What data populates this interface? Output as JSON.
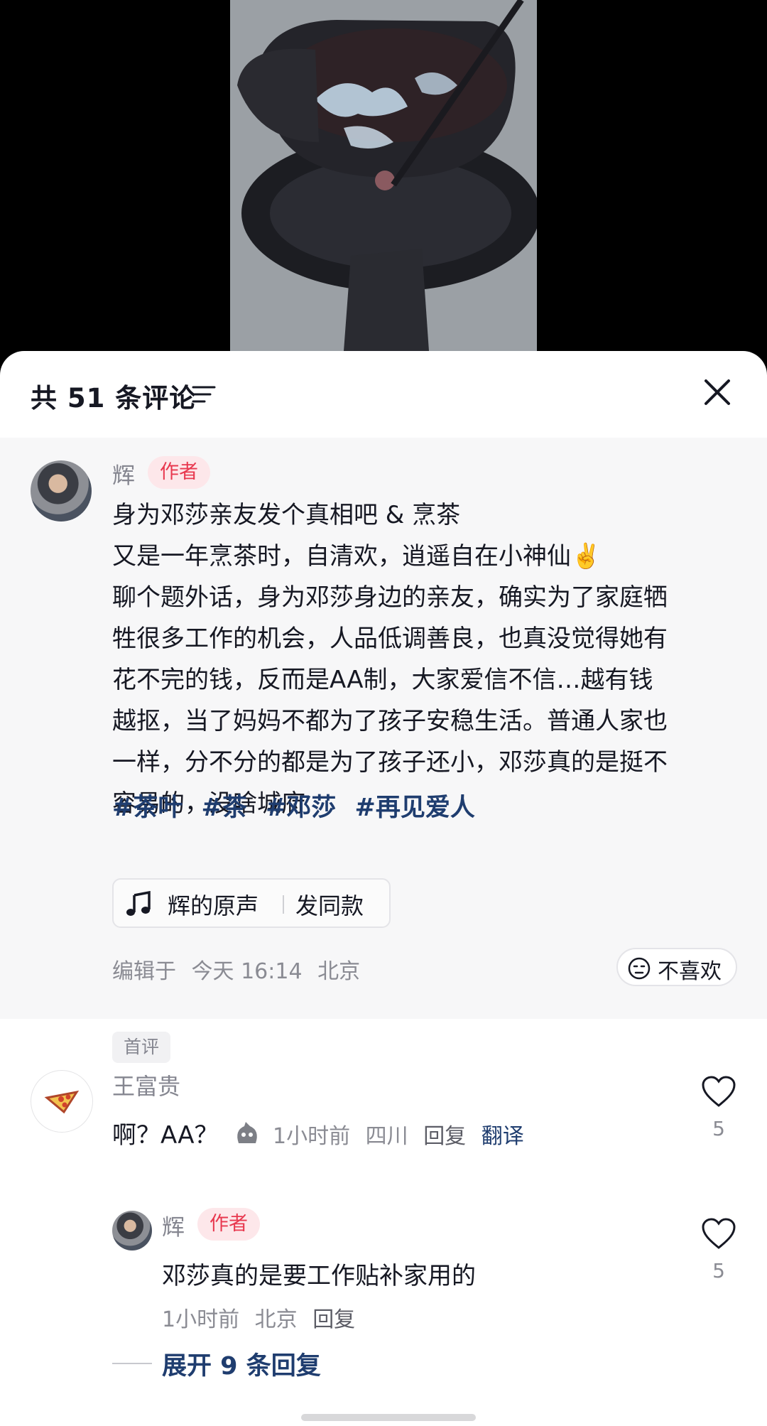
{
  "comments_sheet": {
    "title": "共 51 条评论",
    "pinned_post": {
      "author": "辉",
      "author_badge": "作者",
      "lines": [
        "身为邓莎亲友发个真相吧 & 烹茶",
        "又是一年烹茶时，自清欢，逍遥自在小神仙✌️",
        "聊个题外话，身为邓莎身边的亲友，确实为了家庭牺",
        "牲很多工作的机会，人品低调善良，也真没觉得她有",
        "花不完的钱，反而是AA制，大家爱信不信…越有钱",
        "越抠，当了妈妈不都为了孩子安稳生活。普通人家也",
        "一样，分不分的都是为了孩子还小，邓莎真的是挺不",
        "容易的，没啥城府"
      ],
      "hashtags": [
        "#茶叶",
        "#茶",
        "#邓莎",
        "#再见爱人"
      ],
      "sound_label": "辉的原声",
      "sound_action": "发同款",
      "meta": [
        "编辑于",
        "今天 16:14",
        "北京"
      ],
      "dislike_label": "不喜欢"
    },
    "comments": [
      {
        "user": "王富贵",
        "text": "啊？AA？",
        "time": "1小时前",
        "location": "四川",
        "reply_label": "回复",
        "translate_label": "翻译",
        "likes": "5",
        "tag": "首评"
      }
    ],
    "reply": {
      "user": "辉",
      "author_badge": "作者",
      "text": "邓莎真的是要工作贴补家用的",
      "time": "1小时前",
      "location": "北京",
      "reply_label": "回复",
      "likes": "5"
    },
    "expand_label": "展开 9 条回复"
  }
}
